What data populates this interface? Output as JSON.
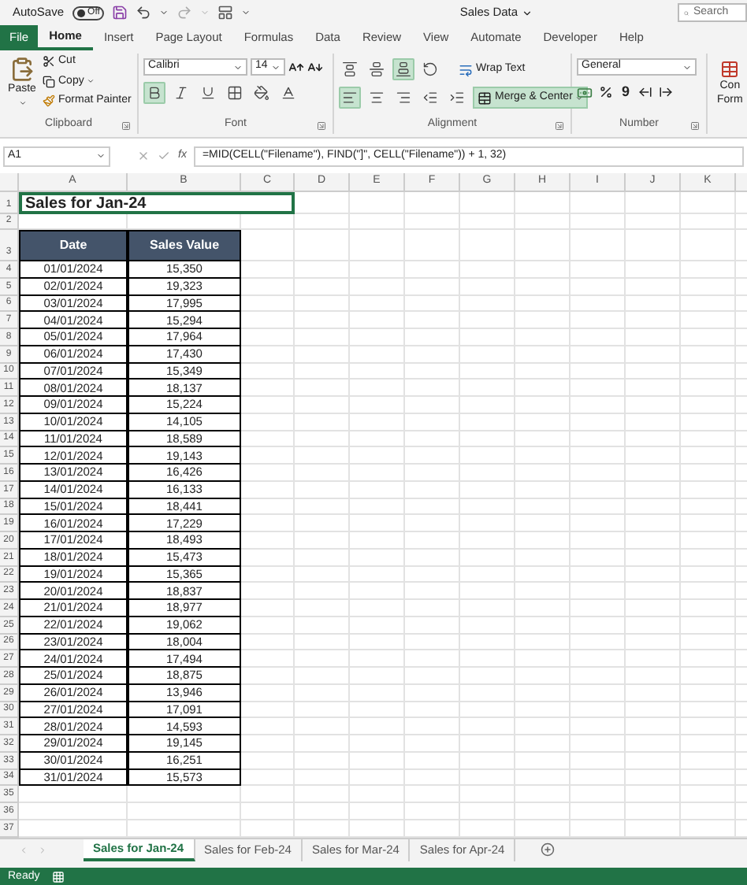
{
  "title_bar": {
    "autosave_label": "AutoSave",
    "autosave_toggle": {
      "label": "Off",
      "on": false
    },
    "document_title": "Sales Data",
    "search": {
      "placeholder": "Search"
    }
  },
  "menu_tabs": [
    {
      "label": "File",
      "kind": "file",
      "selected": false
    },
    {
      "label": "Home",
      "kind": "tab",
      "selected": true
    },
    {
      "label": "Insert",
      "kind": "tab",
      "selected": false
    },
    {
      "label": "Page Layout",
      "kind": "tab",
      "selected": false
    },
    {
      "label": "Formulas",
      "kind": "tab",
      "selected": false
    },
    {
      "label": "Data",
      "kind": "tab",
      "selected": false
    },
    {
      "label": "Review",
      "kind": "tab",
      "selected": false
    },
    {
      "label": "View",
      "kind": "tab",
      "selected": false
    },
    {
      "label": "Automate",
      "kind": "tab",
      "selected": false
    },
    {
      "label": "Developer",
      "kind": "tab",
      "selected": false
    },
    {
      "label": "Help",
      "kind": "tab",
      "selected": false
    }
  ],
  "ribbon": {
    "clipboard": {
      "label": "Clipboard",
      "paste": "Paste",
      "cut": "Cut",
      "copy": "Copy",
      "format_painter": "Format Painter"
    },
    "font": {
      "label": "Font",
      "font_name": "Calibri",
      "font_size": "14",
      "buttons": [
        {
          "kind": "bold",
          "active": true
        },
        {
          "kind": "italic",
          "active": false
        },
        {
          "kind": "underline",
          "active": false
        },
        {
          "kind": "borders",
          "active": false
        },
        {
          "kind": "fill",
          "active": false
        },
        {
          "kind": "font_color",
          "active": false
        }
      ]
    },
    "alignment": {
      "label": "Alignment",
      "top_buttons": [
        {
          "kind": "align_top",
          "active": false
        },
        {
          "kind": "align_middle",
          "active": false
        },
        {
          "kind": "align_bottom",
          "active": true
        },
        {
          "kind": "orientation",
          "active": false
        }
      ],
      "wrap_text": "Wrap Text",
      "bottom_buttons": [
        {
          "kind": "align_left",
          "active": true
        },
        {
          "kind": "align_center",
          "active": false
        },
        {
          "kind": "align_right",
          "active": false
        },
        {
          "kind": "indent_less",
          "active": false
        },
        {
          "kind": "indent_more",
          "active": false
        }
      ],
      "merge": {
        "label": "Merge & Center",
        "active": true
      }
    },
    "number": {
      "label": "Number",
      "format": "General",
      "comma": "9"
    },
    "cut_off_group": [
      "Con",
      "Form"
    ]
  },
  "formula_bar": {
    "name_box": "A1",
    "function_label": "fx",
    "formula": "=MID(CELL(\"Filename\"), FIND(\"]\", CELL(\"Filename\")) + 1, 32)"
  },
  "sheet": {
    "columns": [
      "A",
      "B",
      "C",
      "D",
      "E",
      "F",
      "G",
      "H",
      "I",
      "J",
      "K"
    ],
    "row_numbers": [
      "1",
      "2",
      "3",
      "4",
      "5",
      "6",
      "7",
      "8",
      "9",
      "10",
      "11",
      "12",
      "13",
      "14",
      "15",
      "16",
      "17",
      "18",
      "19",
      "20",
      "21",
      "22",
      "23",
      "24",
      "25",
      "26",
      "27",
      "28",
      "29",
      "30",
      "31",
      "32",
      "33",
      "34",
      "35",
      "36",
      "37"
    ],
    "title_cell": "Sales for Jan-24",
    "table": {
      "columns": [
        "Date",
        "Sales Value"
      ],
      "rows": [
        [
          "01/01/2024",
          "15,350"
        ],
        [
          "02/01/2024",
          "19,323"
        ],
        [
          "03/01/2024",
          "17,995"
        ],
        [
          "04/01/2024",
          "15,294"
        ],
        [
          "05/01/2024",
          "17,964"
        ],
        [
          "06/01/2024",
          "17,430"
        ],
        [
          "07/01/2024",
          "15,349"
        ],
        [
          "08/01/2024",
          "18,137"
        ],
        [
          "09/01/2024",
          "15,224"
        ],
        [
          "10/01/2024",
          "14,105"
        ],
        [
          "11/01/2024",
          "18,589"
        ],
        [
          "12/01/2024",
          "19,143"
        ],
        [
          "13/01/2024",
          "16,426"
        ],
        [
          "14/01/2024",
          "16,133"
        ],
        [
          "15/01/2024",
          "18,441"
        ],
        [
          "16/01/2024",
          "17,229"
        ],
        [
          "17/01/2024",
          "18,493"
        ],
        [
          "18/01/2024",
          "15,473"
        ],
        [
          "19/01/2024",
          "15,365"
        ],
        [
          "20/01/2024",
          "18,837"
        ],
        [
          "21/01/2024",
          "18,977"
        ],
        [
          "22/01/2024",
          "19,062"
        ],
        [
          "23/01/2024",
          "18,004"
        ],
        [
          "24/01/2024",
          "17,494"
        ],
        [
          "25/01/2024",
          "18,875"
        ],
        [
          "26/01/2024",
          "13,946"
        ],
        [
          "27/01/2024",
          "17,091"
        ],
        [
          "28/01/2024",
          "14,593"
        ],
        [
          "29/01/2024",
          "19,145"
        ],
        [
          "30/01/2024",
          "16,251"
        ],
        [
          "31/01/2024",
          "15,573"
        ]
      ]
    }
  },
  "sheet_tabs": [
    {
      "label": "Sales for Jan-24",
      "selected": true
    },
    {
      "label": "Sales for Feb-24",
      "selected": false
    },
    {
      "label": "Sales for Mar-24",
      "selected": false
    },
    {
      "label": "Sales for Apr-24",
      "selected": false
    }
  ],
  "status_bar": {
    "text": "Ready"
  }
}
